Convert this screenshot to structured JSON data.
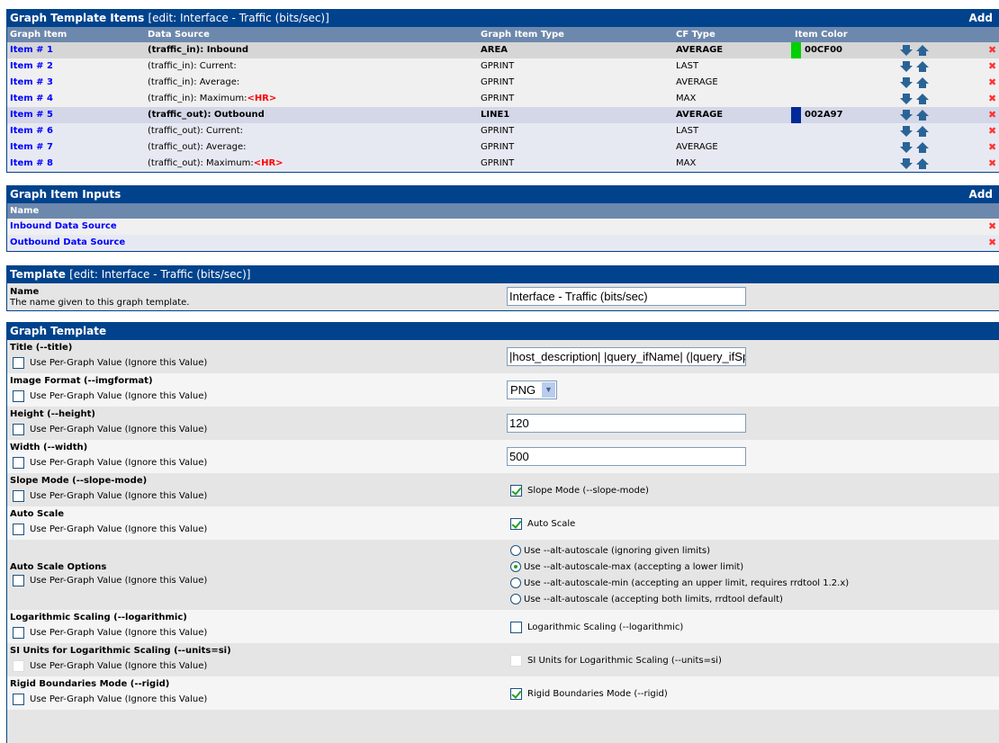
{
  "items_panel": {
    "title": "Graph Template Items",
    "subtitle": "[edit: Interface - Traffic (bits/sec)]",
    "add": "Add",
    "columns": [
      "Graph Item",
      "Data Source",
      "Graph Item Type",
      "CF Type",
      "Item Color"
    ],
    "rows": [
      {
        "item": "Item # 1",
        "source": "(traffic_in): Inbound",
        "hr": "",
        "type": "AREA",
        "cf": "AVERAGE",
        "color": "00CF00",
        "swatch": "#00CF00",
        "bold": true,
        "bg": "#D6D6D6"
      },
      {
        "item": "Item # 2",
        "source": "(traffic_in): Current:",
        "hr": "",
        "type": "GPRINT",
        "cf": "LAST",
        "color": "",
        "bold": false,
        "bg": "#F0F0F0"
      },
      {
        "item": "Item # 3",
        "source": "(traffic_in): Average:",
        "hr": "",
        "type": "GPRINT",
        "cf": "AVERAGE",
        "color": "",
        "bold": false,
        "bg": "#F0F0F0"
      },
      {
        "item": "Item # 4",
        "source": "(traffic_in): Maximum:",
        "hr": "<HR>",
        "type": "GPRINT",
        "cf": "MAX",
        "color": "",
        "bold": false,
        "bg": "#F0F0F0"
      },
      {
        "item": "Item # 5",
        "source": "(traffic_out): Outbound",
        "hr": "",
        "type": "LINE1",
        "cf": "AVERAGE",
        "color": "002A97",
        "swatch": "#002A97",
        "bold": true,
        "bg": "#D4D7E7"
      },
      {
        "item": "Item # 6",
        "source": "(traffic_out): Current:",
        "hr": "",
        "type": "GPRINT",
        "cf": "LAST",
        "color": "",
        "bold": false,
        "bg": "#E7E9F2"
      },
      {
        "item": "Item # 7",
        "source": "(traffic_out): Average:",
        "hr": "",
        "type": "GPRINT",
        "cf": "AVERAGE",
        "color": "",
        "bold": false,
        "bg": "#E7E9F2"
      },
      {
        "item": "Item # 8",
        "source": "(traffic_out): Maximum:",
        "hr": "<HR>",
        "type": "GPRINT",
        "cf": "MAX",
        "color": "",
        "bold": false,
        "bg": "#E7E9F2"
      }
    ]
  },
  "inputs_panel": {
    "title": "Graph Item Inputs",
    "add": "Add",
    "column": "Name",
    "rows": [
      "Inbound Data Source",
      "Outbound Data Source"
    ]
  },
  "template_panel": {
    "title": "Template",
    "subtitle": "[edit: Interface - Traffic (bits/sec)]",
    "name_label": "Name",
    "name_desc": "The name given to this graph template.",
    "name_value": "Interface - Traffic (bits/sec)"
  },
  "graph_panel": {
    "title": "Graph Template",
    "per_graph": "Use Per-Graph Value (Ignore this Value)",
    "fields": [
      {
        "label": "Title (--title)",
        "kind": "text",
        "value": "|host_description| |query_ifName| (|query_ifSpeed|)"
      },
      {
        "label": "Image Format (--imgformat)",
        "kind": "select",
        "value": "PNG"
      },
      {
        "label": "Height (--height)",
        "kind": "text",
        "value": "120"
      },
      {
        "label": "Width (--width)",
        "kind": "text",
        "value": "500"
      },
      {
        "label": "Slope Mode (--slope-mode)",
        "kind": "check",
        "value": "Slope Mode (--slope-mode)",
        "checked": true
      },
      {
        "label": "Auto Scale",
        "kind": "check",
        "value": "Auto Scale",
        "checked": true
      },
      {
        "label": "Auto Scale Options",
        "kind": "radio",
        "options": [
          "Use --alt-autoscale (ignoring given limits)",
          "Use --alt-autoscale-max (accepting a lower limit)",
          "Use --alt-autoscale-min (accepting an upper limit, requires rrdtool 1.2.x)",
          "Use --alt-autoscale (accepting both limits, rrdtool default)"
        ],
        "selected": 1
      },
      {
        "label": "Logarithmic Scaling (--logarithmic)",
        "kind": "check",
        "value": "Logarithmic Scaling (--logarithmic)",
        "checked": false
      },
      {
        "label": "SI Units for Logarithmic Scaling (--units=si)",
        "kind": "check",
        "value": "SI Units for Logarithmic Scaling (--units=si)",
        "checked": false,
        "disabled": true
      },
      {
        "label": "Rigid Boundaries Mode (--rigid)",
        "kind": "check",
        "value": "Rigid Boundaries Mode (--rigid)",
        "checked": true
      }
    ]
  }
}
